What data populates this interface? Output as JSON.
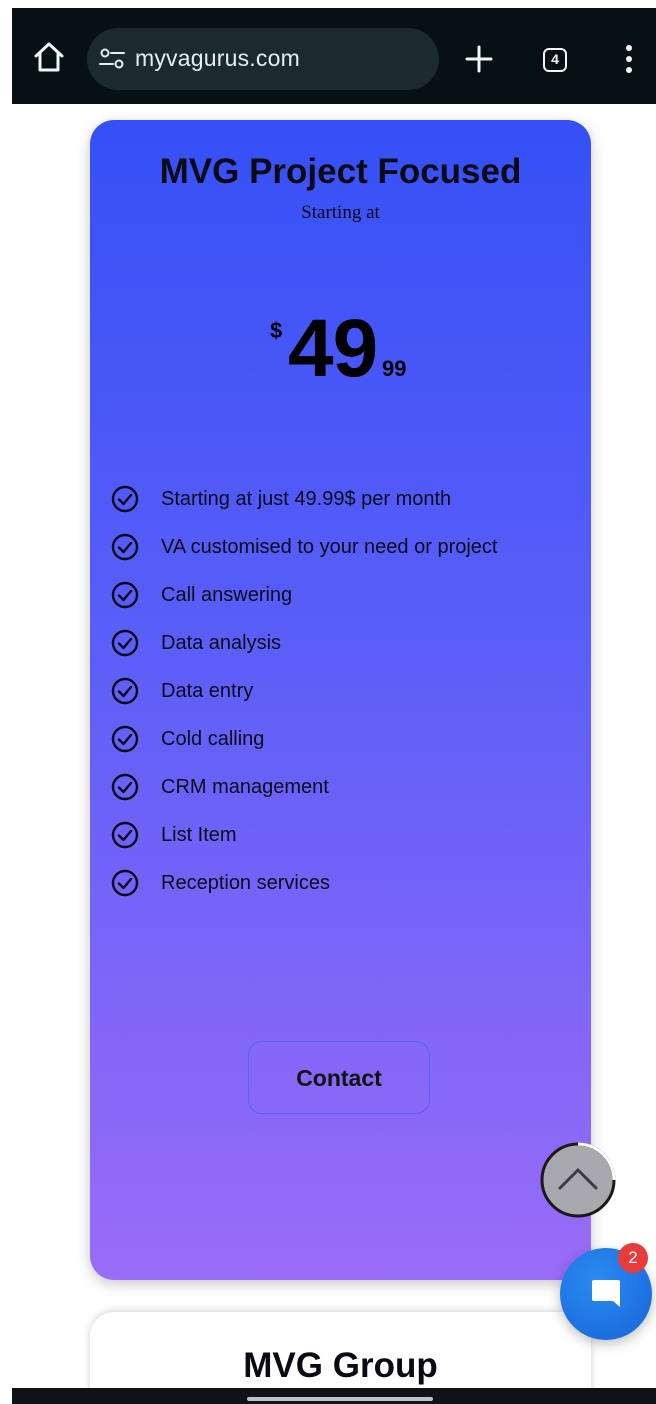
{
  "browser": {
    "url": "myvagurus.com",
    "tab_count": "4",
    "icons": {
      "home": "home-icon",
      "site_settings": "tune-icon",
      "new_tab": "plus-icon",
      "menu": "more-vert-icon"
    }
  },
  "pricing_card": {
    "title": "MVG Project Focused",
    "subtitle": "Starting at",
    "price": {
      "currency": "$",
      "amount": "49",
      "cents": "99"
    },
    "features": [
      "Starting at just 49.99$ per month",
      "VA customised to your need or project",
      "Call answering",
      "Data analysis",
      "Data entry",
      "Cold calling",
      "CRM management",
      "List Item",
      "Reception services"
    ],
    "contact_label": "Contact",
    "colors": {
      "gradient_top": "#3550f6",
      "gradient_bottom": "#9a6cf7"
    }
  },
  "next_card": {
    "title": "MVG Group"
  },
  "chat": {
    "badge_count": "2",
    "color": "#1f73e3",
    "badge_color": "#e83b3b"
  }
}
